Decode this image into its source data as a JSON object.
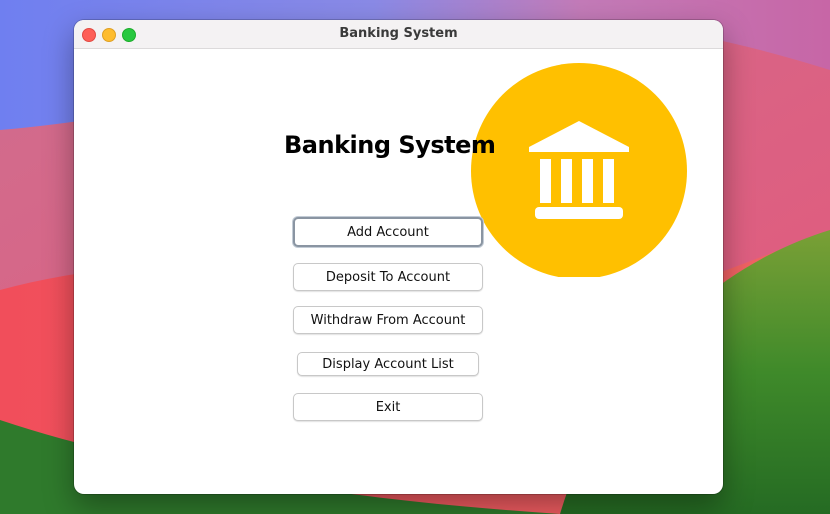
{
  "window": {
    "title": "Banking System"
  },
  "main": {
    "heading": "Banking System",
    "logo_icon": "bank-building-icon",
    "logo_color": "#FFC000",
    "buttons": {
      "add_account": "Add Account",
      "deposit": "Deposit To Account",
      "withdraw": "Withdraw From Account",
      "display_list": "Display Account List",
      "exit": "Exit"
    }
  }
}
